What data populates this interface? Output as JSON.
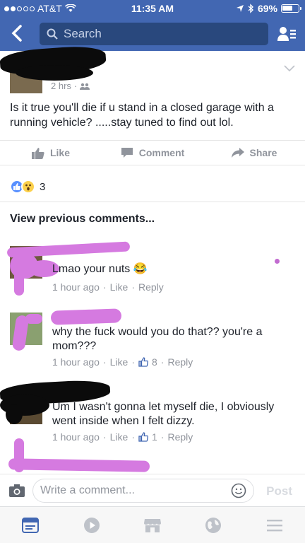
{
  "status_bar": {
    "carrier": "AT&T",
    "time": "11:35 AM",
    "battery": "69%",
    "battery_level": 0.69
  },
  "nav": {
    "search_placeholder": "Search"
  },
  "post": {
    "time": "2 hrs",
    "text": "Is it true you'll die if u stand in a closed garage with a running vehicle? .....stay tuned to find out lol.",
    "actions": {
      "like": "Like",
      "comment": "Comment",
      "share": "Share"
    },
    "reaction_count": "3"
  },
  "view_previous": "View previous comments...",
  "comments": [
    {
      "text": "Lmao your nuts",
      "emoji": "😂",
      "time": "1 hour ago",
      "like": "Like",
      "reply": "Reply"
    },
    {
      "text": "why the fuck would you do that?? you're a mom???",
      "time": "1 hour ago",
      "like": "Like",
      "likes": "8",
      "reply": "Reply"
    },
    {
      "text": "Um I wasn't gonna let myself die,  I obviously went inside when I felt dizzy.",
      "time": "1 hour ago",
      "like": "Like",
      "likes": "1",
      "reply": "Reply"
    }
  ],
  "composer": {
    "placeholder": "Write a comment...",
    "post_label": "Post"
  },
  "colors": {
    "brand": "#4267b2",
    "search_bg": "#29487d",
    "meta": "#90949c",
    "redaction_pink": "#d57ae0"
  }
}
